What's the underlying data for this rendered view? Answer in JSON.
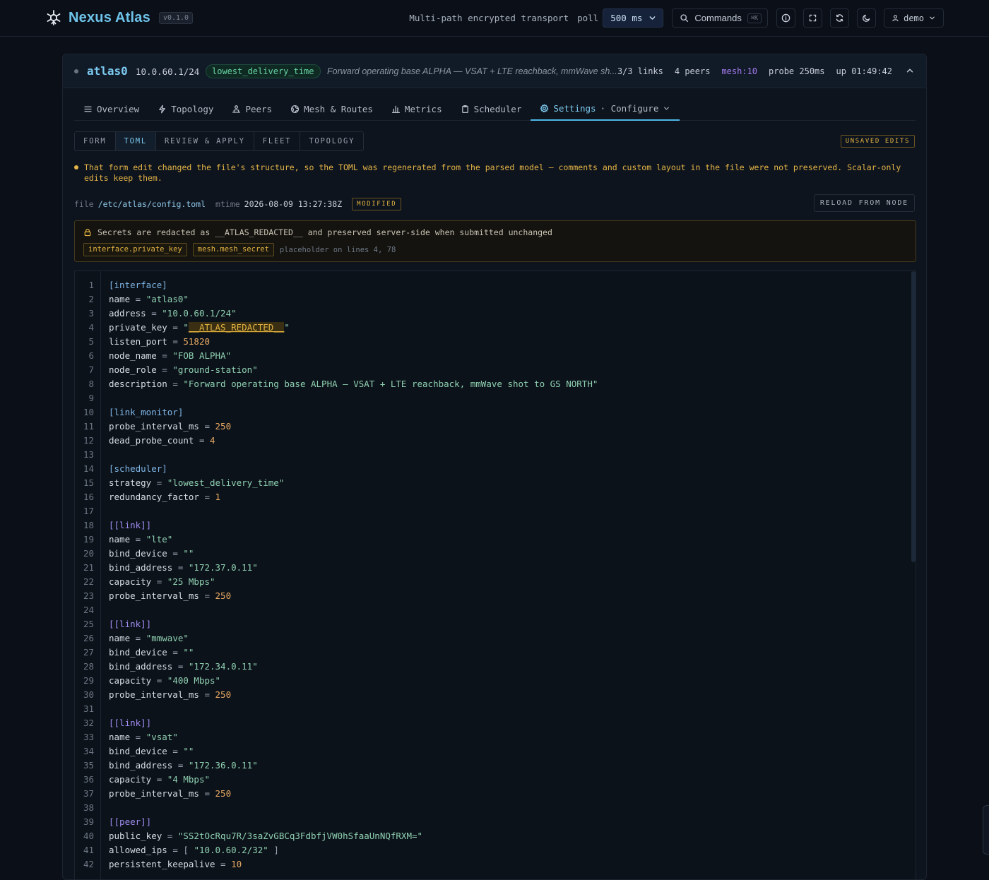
{
  "app": {
    "name": "Nexus Atlas",
    "version": "v0.1.0",
    "tagline": "Multi-path encrypted transport",
    "poll_label": "poll",
    "poll_value": "500 ms",
    "commands_label": "Commands",
    "commands_shortcut": "⌘K",
    "user": "demo"
  },
  "interface": {
    "name": "atlas0",
    "address": "10.0.60.1/24",
    "strategy": "lowest_delivery_time",
    "description": "Forward operating base ALPHA — VSAT + LTE reachback, mmWave sh...",
    "links": "3/3 links",
    "peers": "4 peers",
    "mesh": "mesh:10",
    "probe": "probe 250ms",
    "uptime": "up 01:49:42"
  },
  "tabs": [
    {
      "label": "Overview",
      "icon": "list-icon"
    },
    {
      "label": "Topology",
      "icon": "bolt-icon"
    },
    {
      "label": "Peers",
      "icon": "peers-icon"
    },
    {
      "label": "Mesh & Routes",
      "icon": "globe-icon"
    },
    {
      "label": "Metrics",
      "icon": "bar-chart-icon"
    },
    {
      "label": "Scheduler",
      "icon": "clipboard-icon"
    },
    {
      "label": "Settings",
      "icon": "gear-icon",
      "sub": "· Configure"
    }
  ],
  "subtabs": [
    "FORM",
    "TOML",
    "REVIEW & APPLY",
    "FLEET",
    "TOPOLOGY"
  ],
  "active_subtab": "TOML",
  "unsaved_badge": "UNSAVED EDITS",
  "warning": "That form edit changed the file's structure, so the TOML was regenerated from the parsed model — comments and custom layout in the file were not preserved. Scalar-only edits keep them.",
  "file": {
    "label": "file",
    "path": "/etc/atlas/config.toml",
    "mtime_label": "mtime",
    "mtime": "2026-08-09 13:27:38Z",
    "badge": "MODIFIED",
    "reload_label": "RELOAD FROM NODE"
  },
  "secrets": {
    "message": "Secrets are redacted as __ATLAS_REDACTED__ and preserved server-side when submitted unchanged",
    "fields": [
      "interface.private_key",
      "mesh.mesh_secret"
    ],
    "note": "placeholder on lines 4, 78"
  },
  "code_lines": [
    "[interface]",
    "name = \"atlas0\"",
    "address = \"10.0.60.1/24\"",
    "private_key = \"__ATLAS_REDACTED__\"",
    "listen_port = 51820",
    "node_name = \"FOB ALPHA\"",
    "node_role = \"ground-station\"",
    "description = \"Forward operating base ALPHA — VSAT + LTE reachback, mmWave shot to GS NORTH\"",
    "",
    "[link_monitor]",
    "probe_interval_ms = 250",
    "dead_probe_count = 4",
    "",
    "[scheduler]",
    "strategy = \"lowest_delivery_time\"",
    "redundancy_factor = 1",
    "",
    "[[link]]",
    "name = \"lte\"",
    "bind_device = \"\"",
    "bind_address = \"172.37.0.11\"",
    "capacity = \"25 Mbps\"",
    "probe_interval_ms = 250",
    "",
    "[[link]]",
    "name = \"mmwave\"",
    "bind_device = \"\"",
    "bind_address = \"172.34.0.11\"",
    "capacity = \"400 Mbps\"",
    "probe_interval_ms = 250",
    "",
    "[[link]]",
    "name = \"vsat\"",
    "bind_device = \"\"",
    "bind_address = \"172.36.0.11\"",
    "capacity = \"4 Mbps\"",
    "probe_interval_ms = 250",
    "",
    "[[peer]]",
    "public_key = \"SS2tOcRqu7R/3saZvGBCq3FdbfjVW0hSfaaUnNQfRXM=\"",
    "allowed_ips = [ \"10.0.60.2/32\" ]",
    "persistent_keepalive = 10"
  ],
  "redacted_token": "__ATLAS_REDACTED__",
  "colors": {
    "accent": "#6ec3ea",
    "warning": "#e3b341",
    "success": "#66d3a4",
    "mesh": "#a57cf0"
  }
}
